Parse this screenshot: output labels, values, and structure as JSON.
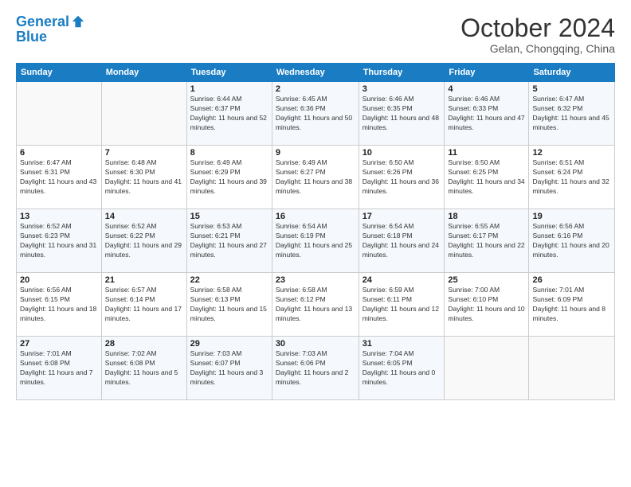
{
  "logo": {
    "line1": "General",
    "line2": "Blue"
  },
  "header": {
    "month": "October 2024",
    "location": "Gelan, Chongqing, China"
  },
  "weekdays": [
    "Sunday",
    "Monday",
    "Tuesday",
    "Wednesday",
    "Thursday",
    "Friday",
    "Saturday"
  ],
  "weeks": [
    [
      {
        "day": "",
        "info": ""
      },
      {
        "day": "",
        "info": ""
      },
      {
        "day": "1",
        "info": "Sunrise: 6:44 AM\nSunset: 6:37 PM\nDaylight: 11 hours and 52 minutes."
      },
      {
        "day": "2",
        "info": "Sunrise: 6:45 AM\nSunset: 6:36 PM\nDaylight: 11 hours and 50 minutes."
      },
      {
        "day": "3",
        "info": "Sunrise: 6:46 AM\nSunset: 6:35 PM\nDaylight: 11 hours and 48 minutes."
      },
      {
        "day": "4",
        "info": "Sunrise: 6:46 AM\nSunset: 6:33 PM\nDaylight: 11 hours and 47 minutes."
      },
      {
        "day": "5",
        "info": "Sunrise: 6:47 AM\nSunset: 6:32 PM\nDaylight: 11 hours and 45 minutes."
      }
    ],
    [
      {
        "day": "6",
        "info": "Sunrise: 6:47 AM\nSunset: 6:31 PM\nDaylight: 11 hours and 43 minutes."
      },
      {
        "day": "7",
        "info": "Sunrise: 6:48 AM\nSunset: 6:30 PM\nDaylight: 11 hours and 41 minutes."
      },
      {
        "day": "8",
        "info": "Sunrise: 6:49 AM\nSunset: 6:29 PM\nDaylight: 11 hours and 39 minutes."
      },
      {
        "day": "9",
        "info": "Sunrise: 6:49 AM\nSunset: 6:27 PM\nDaylight: 11 hours and 38 minutes."
      },
      {
        "day": "10",
        "info": "Sunrise: 6:50 AM\nSunset: 6:26 PM\nDaylight: 11 hours and 36 minutes."
      },
      {
        "day": "11",
        "info": "Sunrise: 6:50 AM\nSunset: 6:25 PM\nDaylight: 11 hours and 34 minutes."
      },
      {
        "day": "12",
        "info": "Sunrise: 6:51 AM\nSunset: 6:24 PM\nDaylight: 11 hours and 32 minutes."
      }
    ],
    [
      {
        "day": "13",
        "info": "Sunrise: 6:52 AM\nSunset: 6:23 PM\nDaylight: 11 hours and 31 minutes."
      },
      {
        "day": "14",
        "info": "Sunrise: 6:52 AM\nSunset: 6:22 PM\nDaylight: 11 hours and 29 minutes."
      },
      {
        "day": "15",
        "info": "Sunrise: 6:53 AM\nSunset: 6:21 PM\nDaylight: 11 hours and 27 minutes."
      },
      {
        "day": "16",
        "info": "Sunrise: 6:54 AM\nSunset: 6:19 PM\nDaylight: 11 hours and 25 minutes."
      },
      {
        "day": "17",
        "info": "Sunrise: 6:54 AM\nSunset: 6:18 PM\nDaylight: 11 hours and 24 minutes."
      },
      {
        "day": "18",
        "info": "Sunrise: 6:55 AM\nSunset: 6:17 PM\nDaylight: 11 hours and 22 minutes."
      },
      {
        "day": "19",
        "info": "Sunrise: 6:56 AM\nSunset: 6:16 PM\nDaylight: 11 hours and 20 minutes."
      }
    ],
    [
      {
        "day": "20",
        "info": "Sunrise: 6:56 AM\nSunset: 6:15 PM\nDaylight: 11 hours and 18 minutes."
      },
      {
        "day": "21",
        "info": "Sunrise: 6:57 AM\nSunset: 6:14 PM\nDaylight: 11 hours and 17 minutes."
      },
      {
        "day": "22",
        "info": "Sunrise: 6:58 AM\nSunset: 6:13 PM\nDaylight: 11 hours and 15 minutes."
      },
      {
        "day": "23",
        "info": "Sunrise: 6:58 AM\nSunset: 6:12 PM\nDaylight: 11 hours and 13 minutes."
      },
      {
        "day": "24",
        "info": "Sunrise: 6:59 AM\nSunset: 6:11 PM\nDaylight: 11 hours and 12 minutes."
      },
      {
        "day": "25",
        "info": "Sunrise: 7:00 AM\nSunset: 6:10 PM\nDaylight: 11 hours and 10 minutes."
      },
      {
        "day": "26",
        "info": "Sunrise: 7:01 AM\nSunset: 6:09 PM\nDaylight: 11 hours and 8 minutes."
      }
    ],
    [
      {
        "day": "27",
        "info": "Sunrise: 7:01 AM\nSunset: 6:08 PM\nDaylight: 11 hours and 7 minutes."
      },
      {
        "day": "28",
        "info": "Sunrise: 7:02 AM\nSunset: 6:08 PM\nDaylight: 11 hours and 5 minutes."
      },
      {
        "day": "29",
        "info": "Sunrise: 7:03 AM\nSunset: 6:07 PM\nDaylight: 11 hours and 3 minutes."
      },
      {
        "day": "30",
        "info": "Sunrise: 7:03 AM\nSunset: 6:06 PM\nDaylight: 11 hours and 2 minutes."
      },
      {
        "day": "31",
        "info": "Sunrise: 7:04 AM\nSunset: 6:05 PM\nDaylight: 11 hours and 0 minutes."
      },
      {
        "day": "",
        "info": ""
      },
      {
        "day": "",
        "info": ""
      }
    ]
  ]
}
